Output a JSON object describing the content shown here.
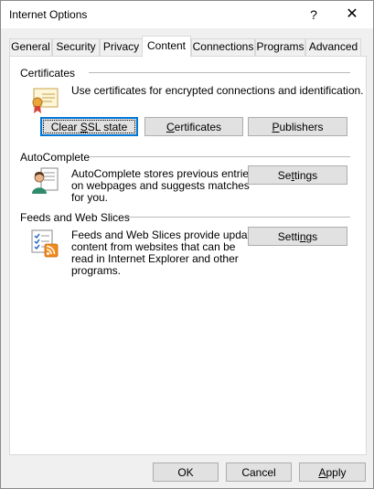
{
  "window": {
    "title": "Internet Options",
    "help_glyph": "?",
    "close_glyph": "✕"
  },
  "tabs": [
    {
      "label": "General"
    },
    {
      "label": "Security"
    },
    {
      "label": "Privacy"
    },
    {
      "label": "Content",
      "active": true
    },
    {
      "label": "Connections"
    },
    {
      "label": "Programs"
    },
    {
      "label": "Advanced"
    }
  ],
  "certificates": {
    "heading": "Certificates",
    "description": "Use certificates for encrypted connections and identification.",
    "clear_ssl": {
      "pre": "Clear ",
      "ul": "S",
      "post": "SL state"
    },
    "certificates_btn": {
      "ul": "C",
      "post": "ertificates"
    },
    "publishers_btn": {
      "ul": "P",
      "post": "ublishers"
    },
    "icon": "certificate-icon"
  },
  "autocomplete": {
    "heading": "AutoComplete",
    "description_lines": [
      "AutoComplete stores previous entries",
      "on webpages and suggests matches",
      "for you."
    ],
    "settings_btn": {
      "pre": "Se",
      "ul": "t",
      "post": "tings"
    },
    "icon": "user-form-icon"
  },
  "feeds": {
    "heading": "Feeds and Web Slices",
    "description_lines": [
      "Feeds and Web Slices provide updated",
      "content from websites that can be",
      "read in Internet Explorer and other",
      "programs."
    ],
    "settings_btn": {
      "pre": "Setti",
      "ul": "n",
      "post": "gs"
    },
    "icon": "rss-feed-icon"
  },
  "footer": {
    "ok": "OK",
    "cancel": "Cancel",
    "apply": {
      "ul": "A",
      "post": "pply"
    }
  },
  "colors": {
    "accent": "#0078d7",
    "button_face": "#e1e1e1",
    "dialog_bg": "#f0f0f0"
  }
}
